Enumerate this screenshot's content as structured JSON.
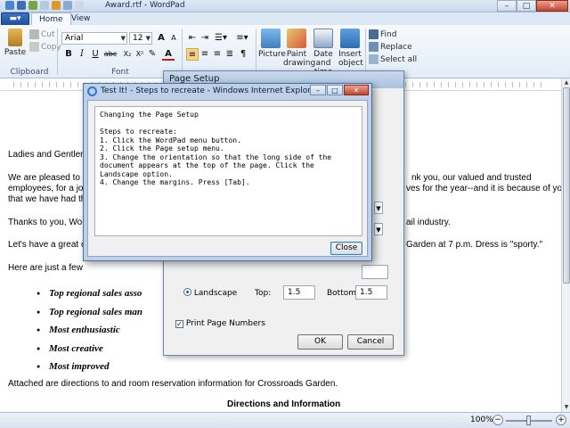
{
  "titlebar": {
    "title": "Award.rtf - WordPad",
    "minimize": "–",
    "maximize": "□",
    "close": "✕"
  },
  "ribbon_tabs": [
    "Home",
    "View"
  ],
  "clipboard": {
    "paste": "Paste",
    "cut": "Cut",
    "copy": "Copy",
    "label": "Clipboard"
  },
  "font": {
    "family": "Arial",
    "size": "12",
    "label": "Font",
    "bold": "B",
    "italic": "I",
    "underline": "U",
    "strike": "abc",
    "sub": "X₂",
    "sup": "X²",
    "grow": "A",
    "shrink": "A",
    "color_a": "A"
  },
  "paragraph": {
    "label": "Paragraph"
  },
  "insert": {
    "picture": "Picture",
    "paint_drawing": [
      "Paint",
      "drawing"
    ],
    "date_time": [
      "Date and",
      "time"
    ],
    "insert_object": [
      "Insert",
      "object"
    ],
    "label": "Insert"
  },
  "editing": {
    "find": "Find",
    "replace": "Replace",
    "select_all": "Select all",
    "label": "Editing"
  },
  "document": {
    "greeting": "Ladies and Gentlem",
    "para1_line1a": "We are pleased to",
    "para1_line1b": "nk you, our valued and trusted",
    "para1_line2a": "employees, for a job",
    "para1_line2b": "ves for the year--and it is because of you",
    "para1_line3": "that we have had thi",
    "para2a": "Thanks to you, Worl",
    "para2b": "ail industry.",
    "para3a": "Let's have a great c",
    "para3b": "Garden at 7 p.m. Dress is \"sporty.\"",
    "para4": "Here are just a few",
    "bullets": [
      "Top regional sales asso",
      "Top regional sales man",
      "Most enthusiastic",
      "Most creative",
      "Most improved"
    ],
    "attached": "Attached are directions to and room reservation information for Crossroads Garden.",
    "heading": "Directions and Information"
  },
  "statusbar": {
    "zoom": "100%",
    "minus": "−",
    "plus": "+"
  },
  "page_setup": {
    "title": "Page Setup",
    "landscape": "Landscape",
    "top_label": "Top:",
    "top_value": "1.5",
    "bottom_label": "Bottom:",
    "bottom_value": "1.5",
    "print_page_numbers": "Print Page Numbers",
    "ok": "OK",
    "cancel": "Cancel"
  },
  "ie_window": {
    "title": "Test It! - Steps to recreate - Windows Internet Explorer",
    "content": "Changing the Page Setup\n\nSteps to recreate:\n1. Click the WordPad menu button.\n2. Click the Page setup menu.\n3. Change the orientation so that the long side of the\ndocument appears at the top of the page. Click the\nLandscape option.\n4. Change the margins. Press [Tab].",
    "close": "Close"
  },
  "colors": {
    "accent": "#1e4f9a",
    "ribbon": "#e3ecf7",
    "close_red": "#c5432b"
  }
}
